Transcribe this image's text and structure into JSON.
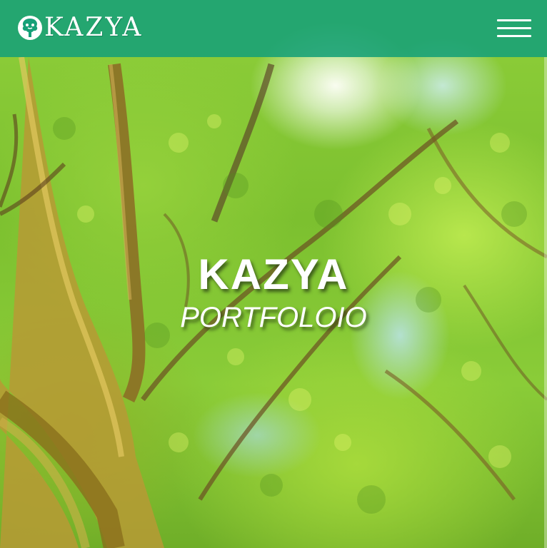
{
  "header": {
    "logo_text": "KAZYA",
    "logo_icon": "tree-face-icon",
    "menu_icon": "hamburger-menu-icon",
    "background_color": "#16a078"
  },
  "hero": {
    "title": "KAZYA",
    "subtitle": "PORTFOLOIO",
    "background": "green tree canopy painting",
    "text_color": "#ffffff"
  }
}
